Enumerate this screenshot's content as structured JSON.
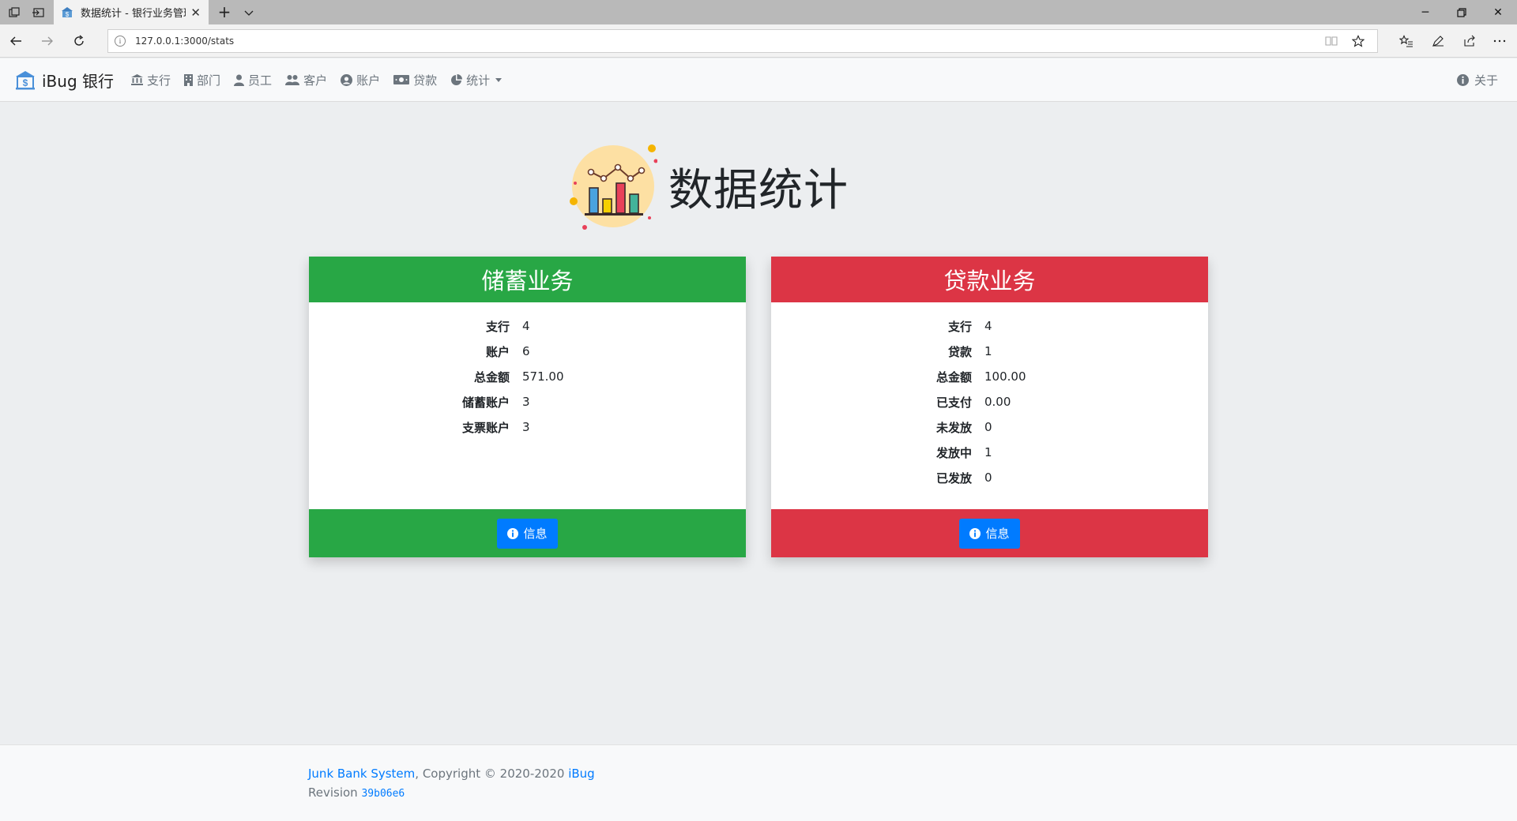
{
  "browser": {
    "tab_title": "数据统计 - 银行业务管理",
    "url": "127.0.0.1:3000/stats"
  },
  "navbar": {
    "brand": "iBug 银行",
    "items": [
      {
        "label": "支行",
        "icon": "bank-icon"
      },
      {
        "label": "部门",
        "icon": "building-icon"
      },
      {
        "label": "员工",
        "icon": "user-icon"
      },
      {
        "label": "客户",
        "icon": "users-icon"
      },
      {
        "label": "账户",
        "icon": "user-circle-icon"
      },
      {
        "label": "贷款",
        "icon": "money-icon"
      },
      {
        "label": "统计",
        "icon": "pie-chart-icon"
      }
    ],
    "about": "关于"
  },
  "page_title": "数据统计",
  "savings": {
    "title": "储蓄业务",
    "rows": [
      {
        "k": "支行",
        "v": "4"
      },
      {
        "k": "账户",
        "v": "6"
      },
      {
        "k": "总金额",
        "v": "571.00"
      },
      {
        "k": "储蓄账户",
        "v": "3"
      },
      {
        "k": "支票账户",
        "v": "3"
      }
    ],
    "button": "信息",
    "color": "#28a745"
  },
  "loans": {
    "title": "贷款业务",
    "rows": [
      {
        "k": "支行",
        "v": "4"
      },
      {
        "k": "贷款",
        "v": "1"
      },
      {
        "k": "总金额",
        "v": "100.00"
      },
      {
        "k": "已支付",
        "v": "0.00"
      },
      {
        "k": "未发放",
        "v": "0"
      },
      {
        "k": "发放中",
        "v": "1"
      },
      {
        "k": "已发放",
        "v": "0"
      }
    ],
    "button": "信息",
    "color": "#dc3545"
  },
  "footer": {
    "project": "Junk Bank System",
    "copyright": ", Copyright © 2020-2020 ",
    "author": "iBug",
    "revision_label": "Revision ",
    "revision": "39b06e6"
  }
}
